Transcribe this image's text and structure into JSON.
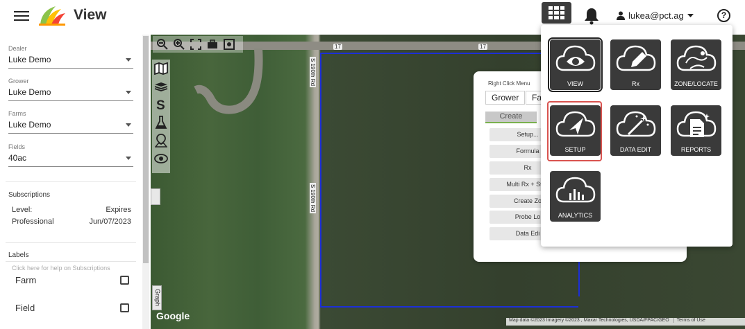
{
  "header": {
    "app_title": "View",
    "user_email": "lukea@pct.ag",
    "help_label": "?"
  },
  "sidebar": {
    "dealer": {
      "label": "Dealer",
      "value": "Luke Demo"
    },
    "grower": {
      "label": "Grower",
      "value": "Luke Demo"
    },
    "farms": {
      "label": "Farms",
      "value": "Luke Demo"
    },
    "fields": {
      "label": "Fields",
      "value": "40ac"
    },
    "subscriptions": {
      "title": "Subscriptions",
      "level_label": "Level:",
      "expires_label": "Expires",
      "level_value": "Professional",
      "expires_value": "Jun/07/2023",
      "help_text": "Click here for help on Subscriptions"
    },
    "labels": {
      "title": "Labels",
      "farm": "Farm",
      "field": "Field"
    }
  },
  "map": {
    "road_label_top_1": "17",
    "road_label_top_2": "17",
    "road_label_vertical_1": "S 190th Rd",
    "road_label_vertical_2": "S 190th Rd",
    "graph_tab": "Graph",
    "google": "Google",
    "credit": "Map data ©2023 Imagery ©2023 , Maxar Technologies, USDA/FPAC/GEO",
    "terms": "Terms of Use"
  },
  "right_click_menu": {
    "title": "Right Click Menu",
    "tab_grower": "Grower",
    "tab_farm": "Fa",
    "create": "Create",
    "buttons": [
      "Setup...",
      "Formula",
      "Rx",
      "Multi Rx + Strip",
      "Create Zo",
      "Probe Lo",
      "Data Edi"
    ]
  },
  "apps_menu": {
    "tiles": [
      {
        "label": "VIEW",
        "icon": "cloud-eye-icon"
      },
      {
        "label": "Rx",
        "icon": "cloud-pencil-icon"
      },
      {
        "label": "ZONE/LOCATE",
        "icon": "cloud-map-icon"
      },
      {
        "label": "SETUP",
        "icon": "cloud-navigation-icon"
      },
      {
        "label": "DATA EDIT",
        "icon": "cloud-wand-icon"
      },
      {
        "label": "REPORTS",
        "icon": "cloud-report-icon"
      },
      {
        "label": "ANALYTICS",
        "icon": "cloud-chart-icon"
      }
    ]
  },
  "colors": {
    "tile_bg": "#3a3a3a",
    "highlight": "#d9534f",
    "field_boundary": "#1c2fd8",
    "create_underline": "#79b04d"
  }
}
